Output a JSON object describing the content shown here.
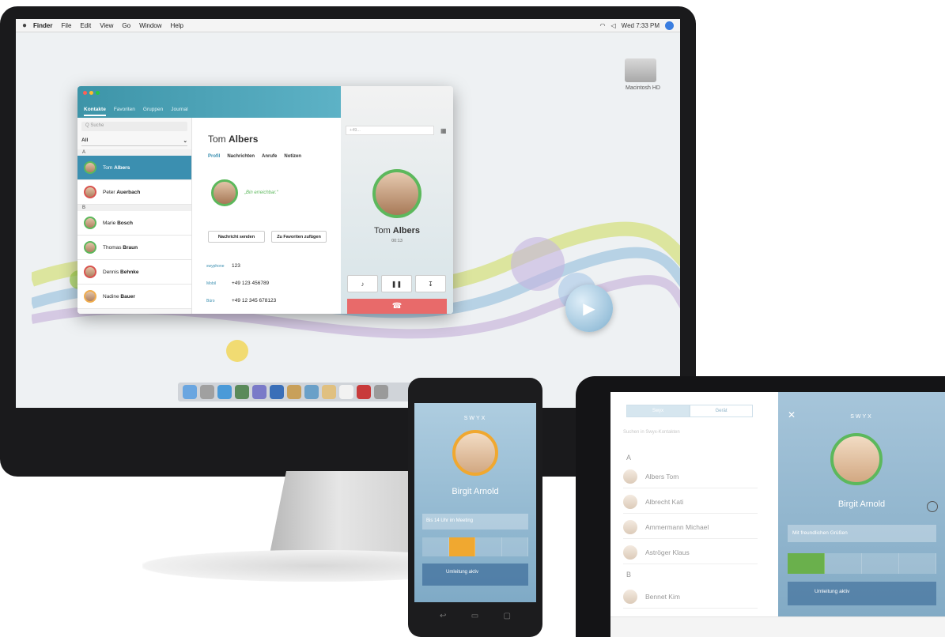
{
  "menubar": {
    "app_name": "Finder",
    "items": [
      "File",
      "Edit",
      "View",
      "Go",
      "Window",
      "Help"
    ],
    "clock": "Wed 7:33 PM"
  },
  "desktop": {
    "hd_label": "Macintosh HD"
  },
  "app": {
    "tabs": [
      "Kontakte",
      "Favoriten",
      "Gruppen",
      "Journal"
    ],
    "search_placeholder": "Q Suche",
    "filter_value": "All",
    "contacts": [
      {
        "letter": "A"
      },
      {
        "first": "Tom",
        "last": "Albers",
        "active": true
      },
      {
        "first": "Peter",
        "last": "Auerbach"
      },
      {
        "letter": "B"
      },
      {
        "first": "Marie",
        "last": "Bosch"
      },
      {
        "first": "Thomas",
        "last": "Braun"
      },
      {
        "first": "Dennis",
        "last": "Behnke"
      },
      {
        "first": "Nadine",
        "last": "Bauer"
      }
    ],
    "detail": {
      "first": "Tom",
      "last": "Albers",
      "tabs": [
        "Profil",
        "Nachrichten",
        "Anrufe",
        "Notizen"
      ],
      "status": "„Bin erreichbar.“",
      "send_message": "Nachricht senden",
      "add_favorite": "Zu Favoriten zufügen",
      "phones": [
        {
          "label": "swyphone",
          "number": "123"
        },
        {
          "label": "Mobil",
          "number": "+49 123 456789"
        },
        {
          "label": "Büro",
          "number": "+49 12 345 678123"
        }
      ]
    },
    "call": {
      "dial_placeholder": "+49...",
      "first": "Tom",
      "last": "Albers",
      "time": "00:13"
    }
  },
  "phone": {
    "logo": "SWYX",
    "name": "Birgit Arnold",
    "message": "Bis 14 Uhr im Meeting",
    "forward": "Umleitung aktiv"
  },
  "tablet": {
    "segments": [
      "Swyx",
      "Gerät"
    ],
    "search_placeholder": "Suchen in Swyx-Kontakten",
    "letter_a": "A",
    "letter_b": "B",
    "contacts": [
      "Albers Tom",
      "Albrecht Kati",
      "Ammermann Michael",
      "Aströger Klaus",
      "Bennet Kim"
    ],
    "logo": "SWYX",
    "name": "Birgit Arnold",
    "message": "Mit freundlichen Grüßen",
    "forward": "Umleitung aktiv"
  }
}
